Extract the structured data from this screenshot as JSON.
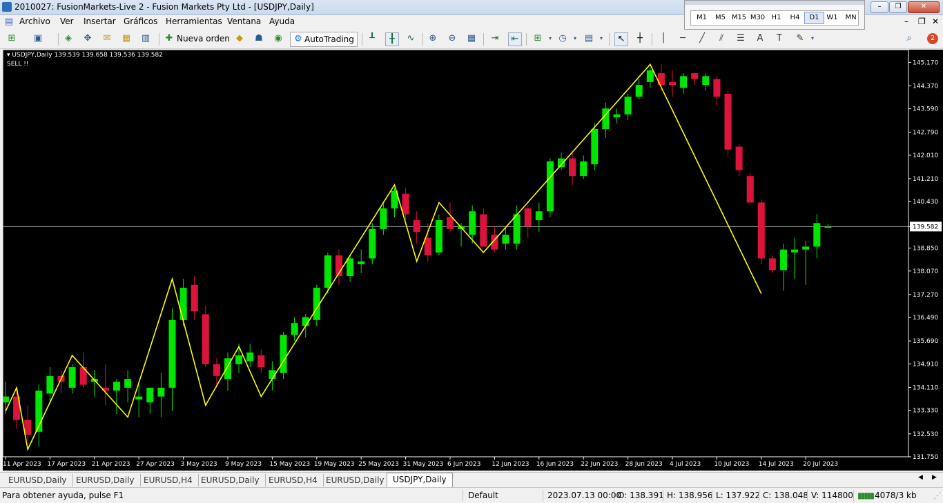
{
  "window": {
    "title": "2010027: FusionMarkets-Live 2 - Fusion Markets Pty Ltd - [USDJPY,Daily]"
  },
  "menu": [
    "Archivo",
    "Ver",
    "Insertar",
    "Gráficos",
    "Herramientas",
    "Ventana",
    "Ayuda"
  ],
  "toolbar": {
    "new_order": "Nueva orden",
    "autotrading": "AutoTrading",
    "notification_count": "2"
  },
  "periods": {
    "items": [
      "M1",
      "M5",
      "M15",
      "M30",
      "H1",
      "H4",
      "D1",
      "W1",
      "MN"
    ],
    "active": "D1"
  },
  "chart_head": {
    "label": "USDJPY,Daily",
    "ohlc": "139.539 139.658 139.536 139.582",
    "note": "SELL !!"
  },
  "chart_data": {
    "type": "candlestick",
    "symbol": "USDJPY",
    "timeframe": "Daily",
    "current_price": 139.582,
    "ylim": [
      131.75,
      145.6
    ],
    "y_ticks": [
      "145.170",
      "144.370",
      "143.590",
      "142.790",
      "142.010",
      "141.210",
      "140.430",
      "139.582",
      "138.850",
      "138.070",
      "137.270",
      "136.490",
      "135.690",
      "134.910",
      "134.110",
      "133.330",
      "132.530",
      "131.750"
    ],
    "x_ticks": [
      "11 Apr 2023",
      "17 Apr 2023",
      "21 Apr 2023",
      "27 Apr 2023",
      "3 May 2023",
      "9 May 2023",
      "15 May 2023",
      "19 May 2023",
      "25 May 2023",
      "31 May 2023",
      "6 Jun 2023",
      "12 Jun 2023",
      "16 Jun 2023",
      "22 Jun 2023",
      "28 Jun 2023",
      "4 Jul 2023",
      "10 Jul 2023",
      "14 Jul 2023",
      "20 Jul 2023"
    ],
    "candles": [
      {
        "o": 133.6,
        "h": 134.3,
        "l": 133.2,
        "c": 133.8
      },
      {
        "o": 133.8,
        "h": 134.0,
        "l": 132.7,
        "c": 133.0
      },
      {
        "o": 133.0,
        "h": 133.5,
        "l": 132.3,
        "c": 132.5
      },
      {
        "o": 132.6,
        "h": 134.2,
        "l": 132.1,
        "c": 134.0
      },
      {
        "o": 133.9,
        "h": 134.8,
        "l": 133.6,
        "c": 134.5
      },
      {
        "o": 134.5,
        "h": 134.7,
        "l": 133.9,
        "c": 134.3
      },
      {
        "o": 134.1,
        "h": 134.9,
        "l": 133.9,
        "c": 134.8
      },
      {
        "o": 134.8,
        "h": 135.3,
        "l": 134.1,
        "c": 134.2
      },
      {
        "o": 134.3,
        "h": 134.7,
        "l": 133.8,
        "c": 134.4
      },
      {
        "o": 134.1,
        "h": 134.9,
        "l": 133.5,
        "c": 134.0
      },
      {
        "o": 134.0,
        "h": 134.4,
        "l": 133.2,
        "c": 134.3
      },
      {
        "o": 134.1,
        "h": 134.7,
        "l": 133.6,
        "c": 134.4
      },
      {
        "o": 133.7,
        "h": 134.2,
        "l": 133.1,
        "c": 133.8
      },
      {
        "o": 133.6,
        "h": 134.0,
        "l": 133.2,
        "c": 134.1
      },
      {
        "o": 133.8,
        "h": 134.6,
        "l": 133.1,
        "c": 134.1
      },
      {
        "o": 134.1,
        "h": 136.8,
        "l": 133.3,
        "c": 136.4
      },
      {
        "o": 136.4,
        "h": 137.8,
        "l": 136.2,
        "c": 137.5
      },
      {
        "o": 137.6,
        "h": 137.9,
        "l": 136.4,
        "c": 136.7
      },
      {
        "o": 136.6,
        "h": 136.9,
        "l": 134.8,
        "c": 134.9
      },
      {
        "o": 134.9,
        "h": 135.1,
        "l": 134.1,
        "c": 134.5
      },
      {
        "o": 134.4,
        "h": 135.3,
        "l": 134.0,
        "c": 135.1
      },
      {
        "o": 134.9,
        "h": 135.6,
        "l": 134.6,
        "c": 135.2
      },
      {
        "o": 135.0,
        "h": 135.6,
        "l": 134.8,
        "c": 135.3
      },
      {
        "o": 135.2,
        "h": 135.4,
        "l": 134.6,
        "c": 134.8
      },
      {
        "o": 134.4,
        "h": 135.0,
        "l": 134.0,
        "c": 134.7
      },
      {
        "o": 134.6,
        "h": 136.0,
        "l": 134.4,
        "c": 135.9
      },
      {
        "o": 135.9,
        "h": 136.5,
        "l": 135.7,
        "c": 136.3
      },
      {
        "o": 136.2,
        "h": 136.6,
        "l": 135.8,
        "c": 136.5
      },
      {
        "o": 136.4,
        "h": 137.6,
        "l": 136.2,
        "c": 137.5
      },
      {
        "o": 137.5,
        "h": 138.7,
        "l": 137.3,
        "c": 138.6
      },
      {
        "o": 138.6,
        "h": 138.8,
        "l": 137.6,
        "c": 137.9
      },
      {
        "o": 137.9,
        "h": 138.6,
        "l": 137.7,
        "c": 138.5
      },
      {
        "o": 138.3,
        "h": 138.8,
        "l": 138.0,
        "c": 138.4
      },
      {
        "o": 138.5,
        "h": 139.7,
        "l": 138.3,
        "c": 139.5
      },
      {
        "o": 139.5,
        "h": 140.4,
        "l": 139.3,
        "c": 140.2
      },
      {
        "o": 140.2,
        "h": 140.9,
        "l": 139.9,
        "c": 140.8
      },
      {
        "o": 140.7,
        "h": 140.9,
        "l": 139.8,
        "c": 140.0
      },
      {
        "o": 139.8,
        "h": 140.1,
        "l": 139.0,
        "c": 139.4
      },
      {
        "o": 139.2,
        "h": 139.7,
        "l": 138.4,
        "c": 138.6
      },
      {
        "o": 138.7,
        "h": 140.0,
        "l": 138.6,
        "c": 139.8
      },
      {
        "o": 139.9,
        "h": 140.4,
        "l": 139.4,
        "c": 139.5
      },
      {
        "o": 139.5,
        "h": 139.7,
        "l": 138.9,
        "c": 139.6
      },
      {
        "o": 139.3,
        "h": 140.3,
        "l": 139.0,
        "c": 140.1
      },
      {
        "o": 140.0,
        "h": 140.2,
        "l": 138.9,
        "c": 138.9
      },
      {
        "o": 139.3,
        "h": 139.6,
        "l": 138.7,
        "c": 138.8
      },
      {
        "o": 139.0,
        "h": 139.6,
        "l": 138.8,
        "c": 139.3
      },
      {
        "o": 139.0,
        "h": 140.3,
        "l": 138.8,
        "c": 140.0
      },
      {
        "o": 140.2,
        "h": 140.3,
        "l": 139.2,
        "c": 139.6
      },
      {
        "o": 139.8,
        "h": 140.4,
        "l": 139.4,
        "c": 140.1
      },
      {
        "o": 140.1,
        "h": 141.9,
        "l": 139.9,
        "c": 141.8
      },
      {
        "o": 141.6,
        "h": 142.1,
        "l": 141.5,
        "c": 141.9
      },
      {
        "o": 141.9,
        "h": 142.1,
        "l": 141.0,
        "c": 141.3
      },
      {
        "o": 141.3,
        "h": 142.0,
        "l": 141.2,
        "c": 141.8
      },
      {
        "o": 141.7,
        "h": 143.1,
        "l": 141.5,
        "c": 142.9
      },
      {
        "o": 142.9,
        "h": 143.8,
        "l": 142.6,
        "c": 143.6
      },
      {
        "o": 143.3,
        "h": 143.6,
        "l": 143.1,
        "c": 143.4
      },
      {
        "o": 143.4,
        "h": 144.1,
        "l": 143.2,
        "c": 144.0
      },
      {
        "o": 144.0,
        "h": 144.6,
        "l": 143.9,
        "c": 144.4
      },
      {
        "o": 144.5,
        "h": 145.0,
        "l": 144.3,
        "c": 144.9
      },
      {
        "o": 144.8,
        "h": 145.1,
        "l": 144.2,
        "c": 144.4
      },
      {
        "o": 144.5,
        "h": 144.9,
        "l": 144.0,
        "c": 144.4
      },
      {
        "o": 144.3,
        "h": 144.8,
        "l": 144.1,
        "c": 144.7
      },
      {
        "o": 144.8,
        "h": 144.8,
        "l": 144.4,
        "c": 144.6
      },
      {
        "o": 144.4,
        "h": 144.8,
        "l": 144.2,
        "c": 144.7
      },
      {
        "o": 144.6,
        "h": 144.7,
        "l": 143.7,
        "c": 144.0
      },
      {
        "o": 144.1,
        "h": 144.2,
        "l": 142.0,
        "c": 142.2
      },
      {
        "o": 142.3,
        "h": 142.4,
        "l": 141.3,
        "c": 141.5
      },
      {
        "o": 141.3,
        "h": 141.4,
        "l": 140.4,
        "c": 140.4
      },
      {
        "o": 140.4,
        "h": 140.5,
        "l": 138.3,
        "c": 138.5
      },
      {
        "o": 138.5,
        "h": 138.6,
        "l": 138.0,
        "c": 138.1
      },
      {
        "o": 138.1,
        "h": 139.0,
        "l": 137.4,
        "c": 138.8
      },
      {
        "o": 138.7,
        "h": 139.2,
        "l": 137.8,
        "c": 138.8
      },
      {
        "o": 138.8,
        "h": 139.1,
        "l": 137.6,
        "c": 138.9
      },
      {
        "o": 138.9,
        "h": 140.0,
        "l": 138.5,
        "c": 139.7
      },
      {
        "o": 139.54,
        "h": 139.66,
        "l": 139.54,
        "c": 139.58
      }
    ],
    "zigzag": [
      {
        "i": 0,
        "p": 133.3
      },
      {
        "i": 1,
        "p": 134.1
      },
      {
        "i": 2,
        "p": 132.0
      },
      {
        "i": 6,
        "p": 135.2
      },
      {
        "i": 11,
        "p": 133.1
      },
      {
        "i": 15,
        "p": 137.8
      },
      {
        "i": 18,
        "p": 133.5
      },
      {
        "i": 21,
        "p": 135.5
      },
      {
        "i": 23,
        "p": 133.8
      },
      {
        "i": 35,
        "p": 141.0
      },
      {
        "i": 37,
        "p": 138.4
      },
      {
        "i": 39,
        "p": 140.4
      },
      {
        "i": 43,
        "p": 138.7
      },
      {
        "i": 58,
        "p": 145.1
      },
      {
        "i": 68,
        "p": 137.3
      }
    ]
  },
  "tabs": [
    "EURUSD,Daily",
    "EURUSD,Daily",
    "EURUSD,H4",
    "EURUSD,Daily",
    "EURUSD,H4",
    "EURUSD,Daily",
    "USDJPY,Daily"
  ],
  "active_tab": "USDJPY,Daily",
  "status": {
    "help": "Para obtener ayuda, pulse F1",
    "profile": "Default",
    "datetime": "2023.07.13 00:00",
    "open": "O: 138.391",
    "high": "H: 138.956",
    "low": "L: 137.922",
    "close": "C: 138.048",
    "volume": "V: 114800",
    "traffic": "4078/3 kb"
  }
}
